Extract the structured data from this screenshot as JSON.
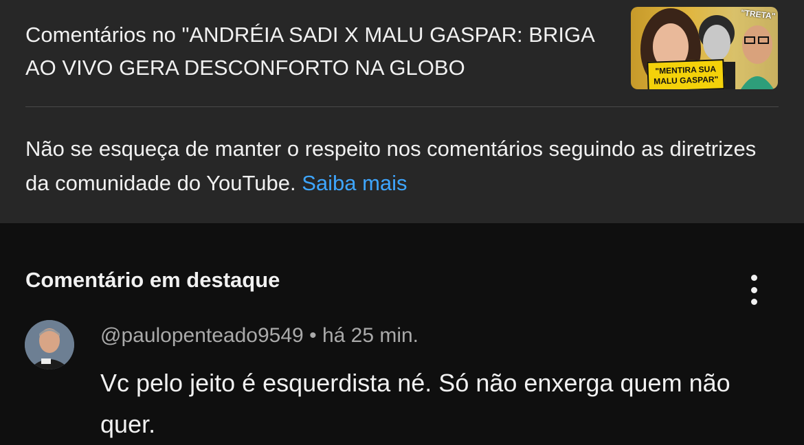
{
  "video": {
    "title_line": "Comentários no \"ANDRÉIA SADI X MALU GASPAR: BRIGA AO VIVO GERA DESCONFORTO NA GLOBO",
    "thumbnail": {
      "caption": "\"MENTIRA SUA MALU GASPAR\"",
      "tag": "\"TRETA\""
    }
  },
  "notice": {
    "text": "Não se esqueça de manter o respeito nos comentários seguindo as diretrizes da comunidade do YouTube.",
    "link_label": "Saiba mais"
  },
  "section": {
    "title": "Comentário em destaque",
    "menu_icon": "more-vertical-icon"
  },
  "comment": {
    "handle": "@paulopenteado9549",
    "separator": "•",
    "time": "há 25 min.",
    "text": "Vc pelo jeito é esquerdista né. Só não enxerga quem não quer."
  },
  "colors": {
    "panel": "#272727",
    "background": "#0f0f0f",
    "link": "#3ea6ff",
    "meta": "#aaaaaa"
  }
}
